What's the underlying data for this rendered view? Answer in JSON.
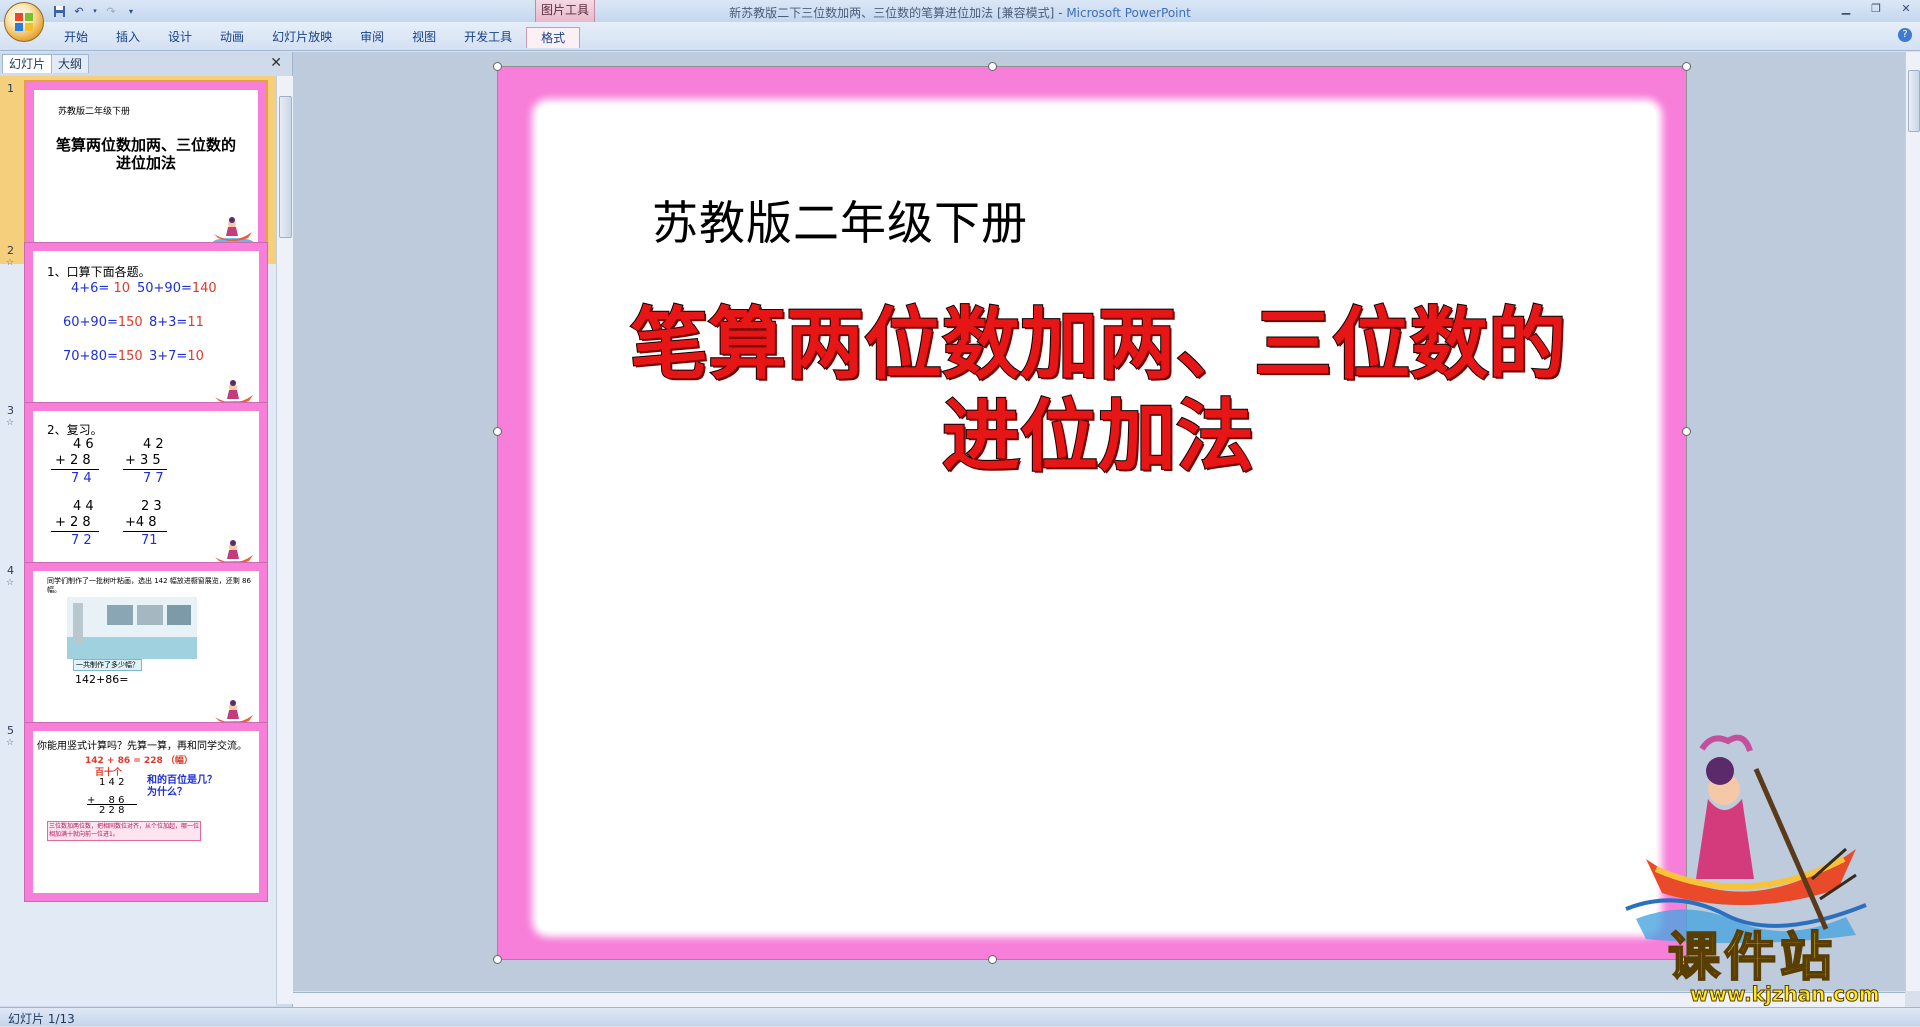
{
  "window": {
    "title": "新苏教版二下三位数加两、三位数的笔算进位加法 [兼容模式] - ",
    "app_name": "Microsoft PowerPoint",
    "context_group": "图片工具"
  },
  "ribbon": {
    "tabs": [
      "开始",
      "插入",
      "设计",
      "动画",
      "幻灯片放映",
      "审阅",
      "视图",
      "开发工具",
      "格式"
    ]
  },
  "pane": {
    "tabs": [
      "幻灯片",
      "大纲"
    ]
  },
  "thumbnails": {
    "s1": {
      "num": "1",
      "subtitle": "苏教版二年级下册",
      "title1": "笔算两位数加两、三位数的",
      "title2": "进位加法"
    },
    "s2": {
      "num": "2",
      "heading": "1、口算下面各题。",
      "q1": "4+6=",
      "a1": "10",
      "q2": "50+90=",
      "a2": "140",
      "q3": "60+90=",
      "a3": "150",
      "q4": "8+3=",
      "a4": "11",
      "q5": "70+80=",
      "a5": "150",
      "q6": "3+7=",
      "a6": "10"
    },
    "s3": {
      "num": "3",
      "heading": "2、复习。",
      "p1a": "4 6",
      "p1b": "+ 2 8",
      "p1r": "7 4",
      "p2a": "4 2",
      "p2b": "+ 3 5",
      "p2r": "7 7",
      "p3a": "4 4",
      "p3b": "+ 2 8",
      "p3r": "7 2",
      "p4a": "2 3",
      "p4b": "+4 8",
      "p4r": "71"
    },
    "s4": {
      "num": "4",
      "text": "同学们制作了一批树叶粘画，选出 142 幅放进橱窗展览，还剩 86 幅。",
      "bubble": "一共制作了多少幅？",
      "eq": "142+86="
    },
    "s5": {
      "num": "5",
      "q": "你能用竖式计算吗？先算一算，再和同学交流。",
      "eq": "142 + 86 =  228 （幅）",
      "places": "百十个",
      "n1": "1 4 2",
      "n2": "+ 　8 6",
      "r": "2 2 8",
      "side": "和的百位是几？为什么？",
      "rule": "三位数加两位数，把相同数位对齐，从个位加起，哪一位相加满十就向前一位进1。"
    }
  },
  "slide": {
    "subtitle": "苏教版二年级下册",
    "title_line1": "笔算两位数加两、三位数的",
    "title_line2": "进位加法"
  },
  "status": {
    "slide_counter": "幻灯片 1/13"
  },
  "watermark": {
    "cn": "课件站",
    "url": "www.kjzhan.com"
  },
  "colors": {
    "slide_border": "#f77ed9",
    "title_red": "#e61616",
    "answer_blue": "#1f2fd6",
    "answer_red": "#e03a2a"
  }
}
